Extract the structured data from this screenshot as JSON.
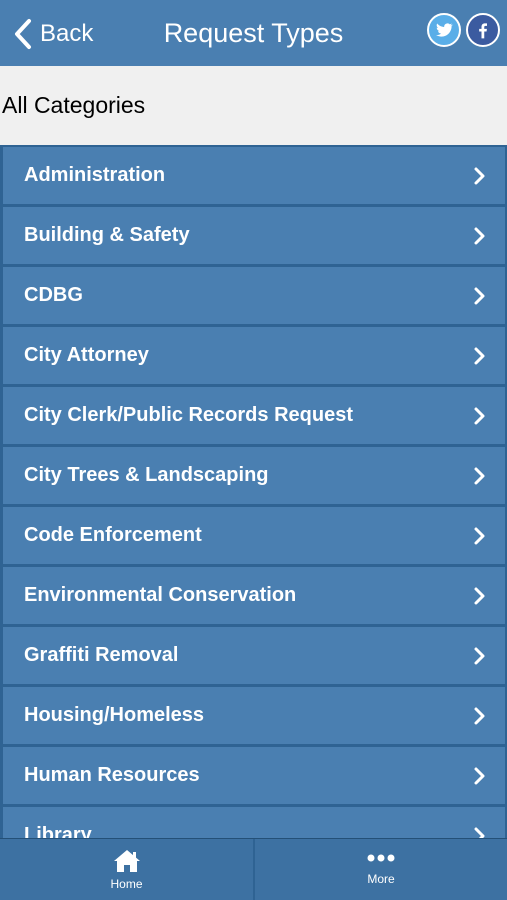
{
  "header": {
    "back_label": "Back",
    "title": "Request Types",
    "twitter_icon": "twitter-icon",
    "facebook_icon": "facebook-icon"
  },
  "filter": {
    "label": "All Categories"
  },
  "categories": [
    "Administration",
    "Building & Safety",
    "CDBG",
    "City Attorney",
    "City Clerk/Public Records Request",
    "City Trees & Landscaping",
    "Code Enforcement",
    "Environmental Conservation",
    "Graffiti Removal",
    "Housing/Homeless",
    "Human Resources",
    "Library"
  ],
  "tabbar": {
    "home_label": "Home",
    "more_label": "More"
  },
  "colors": {
    "header": "#4a7fb1",
    "row": "#4a7fb1",
    "divider": "#2f6393",
    "filter_bg": "#f0f0f0"
  }
}
